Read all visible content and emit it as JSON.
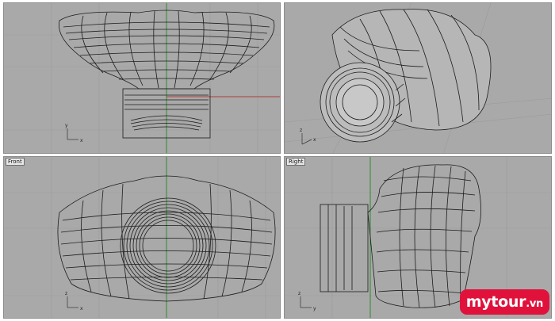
{
  "viewports": {
    "top": {
      "label": ""
    },
    "perspective": {
      "label": ""
    },
    "front": {
      "label": "Front"
    },
    "right": {
      "label": "Right"
    }
  },
  "axis_labels": {
    "x": "x",
    "y": "y",
    "z": "z"
  },
  "watermark": {
    "brand": "mytour",
    "tld": ".vn"
  },
  "colors": {
    "viewport_bg": "#a9a9a9",
    "wire": "#1c1c1c",
    "axis_green": "#2e8b2e",
    "axis_red": "#b33a3a",
    "grid": "#9a9a9a",
    "watermark_bg": "#e0123c"
  }
}
